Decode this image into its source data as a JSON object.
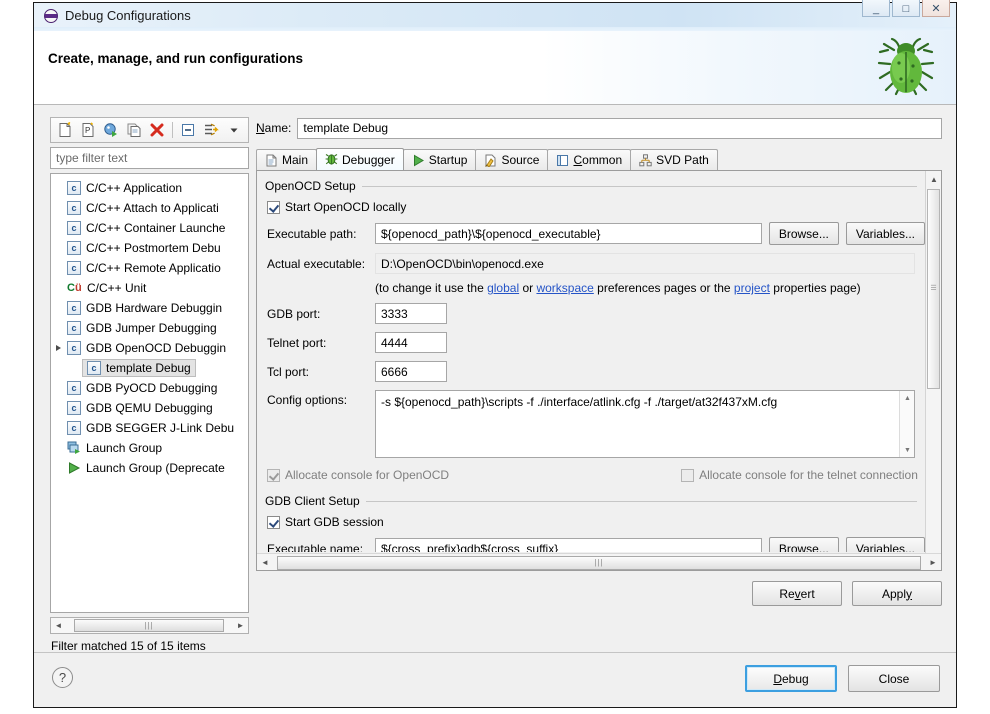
{
  "window": {
    "title": "Debug Configurations",
    "icon": "eclipse-debug-icon",
    "controls": {
      "minimize": "_",
      "maximize": "□",
      "close": "✕"
    }
  },
  "header": {
    "title": "Create, manage, and run configurations",
    "icon": "green-bug-icon"
  },
  "left_panel": {
    "toolbar": [
      {
        "name": "new-configuration-icon",
        "tooltip": "New launch configuration"
      },
      {
        "name": "new-prototype-icon",
        "tooltip": "New launch configuration prototype"
      },
      {
        "name": "new-launch-group-icon",
        "tooltip": "New launch group"
      },
      {
        "name": "duplicate-icon",
        "tooltip": "Duplicate currently selected launch configuration"
      },
      {
        "name": "delete-icon",
        "tooltip": "Delete selected launch configuration(s)"
      },
      {
        "name": "collapse-all-icon",
        "tooltip": "Collapse All"
      },
      {
        "name": "filter-icon",
        "tooltip": "Filter launch configurations"
      },
      {
        "name": "view-menu-icon",
        "tooltip": "View Menu"
      }
    ],
    "filter": {
      "placeholder": "type filter text",
      "value": ""
    },
    "tree": [
      {
        "label": "C/C++ Application",
        "icon": "c-config-icon",
        "level": 0,
        "selected": false,
        "expandable": false
      },
      {
        "label": "C/C++ Attach to Applicati",
        "icon": "c-config-icon",
        "level": 0,
        "selected": false,
        "expandable": false
      },
      {
        "label": "C/C++ Container Launche",
        "icon": "c-config-icon",
        "level": 0,
        "selected": false,
        "expandable": false
      },
      {
        "label": "C/C++ Postmortem Debu",
        "icon": "c-config-icon",
        "level": 0,
        "selected": false,
        "expandable": false
      },
      {
        "label": "C/C++ Remote Applicatio",
        "icon": "c-config-icon",
        "level": 0,
        "selected": false,
        "expandable": false
      },
      {
        "label": "C/C++ Unit",
        "icon": "cunit-icon",
        "level": 0,
        "selected": false,
        "expandable": false
      },
      {
        "label": "GDB Hardware Debuggin",
        "icon": "c-config-icon",
        "level": 0,
        "selected": false,
        "expandable": false
      },
      {
        "label": "GDB Jumper Debugging",
        "icon": "c-config-icon",
        "level": 0,
        "selected": false,
        "expandable": false
      },
      {
        "label": "GDB OpenOCD Debuggin",
        "icon": "c-config-icon",
        "level": 0,
        "selected": false,
        "expandable": true
      },
      {
        "label": "template Debug",
        "icon": "c-config-icon",
        "level": 1,
        "selected": true,
        "expandable": false
      },
      {
        "label": "GDB PyOCD Debugging",
        "icon": "c-config-icon",
        "level": 0,
        "selected": false,
        "expandable": false
      },
      {
        "label": "GDB QEMU Debugging",
        "icon": "c-config-icon",
        "level": 0,
        "selected": false,
        "expandable": false
      },
      {
        "label": "GDB SEGGER J-Link Debu",
        "icon": "c-config-icon",
        "level": 0,
        "selected": false,
        "expandable": false
      },
      {
        "label": "Launch Group",
        "icon": "launch-group-icon",
        "level": 0,
        "selected": false,
        "expandable": false
      },
      {
        "label": "Launch Group (Deprecate",
        "icon": "launch-group-deprecated-icon",
        "level": 0,
        "selected": false,
        "expandable": false
      }
    ],
    "status": "Filter matched 15 of 15 items"
  },
  "right_panel": {
    "name_label": "Name:",
    "name_value": "template Debug",
    "tabs": [
      {
        "label": "Main",
        "icon": "main-tab-icon",
        "active": false
      },
      {
        "label": "Debugger",
        "icon": "debugger-tab-icon",
        "active": true
      },
      {
        "label": "Startup",
        "icon": "startup-tab-icon",
        "active": false
      },
      {
        "label": "Source",
        "icon": "source-tab-icon",
        "active": false
      },
      {
        "label": "Common",
        "icon": "common-tab-icon",
        "active": false
      },
      {
        "label": "SVD Path",
        "icon": "svd-path-tab-icon",
        "active": false
      }
    ],
    "openocd_setup": {
      "group_title": "OpenOCD Setup",
      "start_locally_label": "Start OpenOCD locally",
      "start_locally_checked": true,
      "executable_path_label": "Executable path:",
      "executable_path_value": "${openocd_path}\\${openocd_executable}",
      "browse_label": "Browse...",
      "variables_label": "Variables...",
      "actual_executable_label": "Actual executable:",
      "actual_executable_value": "D:\\OpenOCD\\bin\\openocd.exe",
      "hint_prefix": "(to change it use the ",
      "hint_link_global": "global",
      "hint_mid1": " or ",
      "hint_link_workspace": "workspace",
      "hint_mid2": " preferences pages or the ",
      "hint_link_project": "project",
      "hint_suffix": " properties page)",
      "gdb_port_label": "GDB port:",
      "gdb_port_value": "3333",
      "telnet_port_label": "Telnet port:",
      "telnet_port_value": "4444",
      "tcl_port_label": "Tcl port:",
      "tcl_port_value": "6666",
      "config_options_label": "Config options:",
      "config_options_value": "-s ${openocd_path}\\scripts -f ./interface/atlink.cfg -f ./target/at32f437xM.cfg",
      "allocate_console_openocd_label": "Allocate console for OpenOCD",
      "allocate_console_openocd_checked": true,
      "allocate_console_openocd_enabled": false,
      "allocate_console_telnet_label": "Allocate console for the telnet connection",
      "allocate_console_telnet_checked": false,
      "allocate_console_telnet_enabled": false
    },
    "gdb_client_setup": {
      "group_title": "GDB Client Setup",
      "start_gdb_label": "Start GDB session",
      "start_gdb_checked": true,
      "executable_name_label": "Executable name:",
      "executable_name_value": "${cross_prefix}gdb${cross_suffix}",
      "browse_label": "Browse...",
      "variables_label": "Variables..."
    },
    "revert_label": "Revert",
    "apply_label": "Apply"
  },
  "footer": {
    "help_icon": "help-question-icon",
    "debug_label": "Debug",
    "close_label": "Close"
  },
  "colors": {
    "titlebar_gradient_start": "#eaf3fb",
    "titlebar_gradient_end": "#cfe4f6",
    "link": "#2554c7",
    "focus_border": "#3c9fe0",
    "selection_bg": "#e3e3e3",
    "dialog_bg": "#f0f0f0",
    "delete_icon": "#d52b1e",
    "bug_icon": "#5aa62e"
  }
}
